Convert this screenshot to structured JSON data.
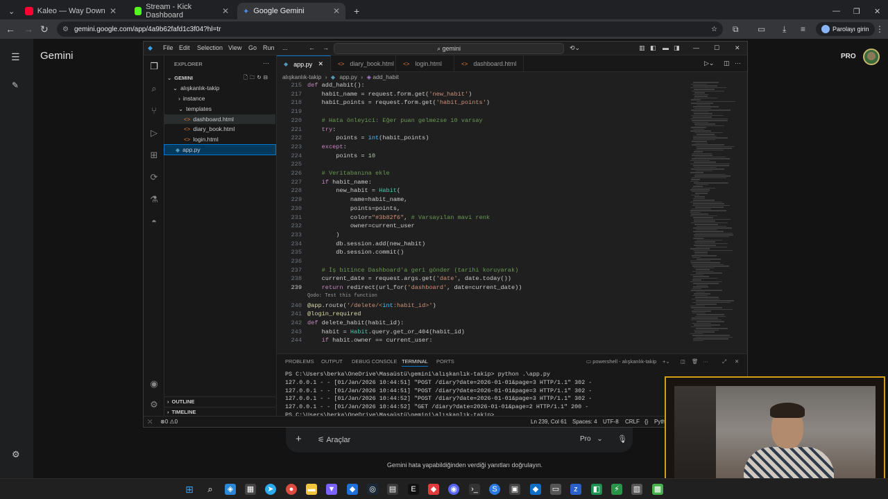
{
  "browser": {
    "tabs": [
      {
        "title": "Kaleo — Way Down We Go"
      },
      {
        "title": "Stream - Kick Dashboard"
      },
      {
        "title": "Google Gemini"
      }
    ],
    "url": "gemini.google.com/app/4a9b62fafd1c3f04?hl=tr",
    "profile_label": "Parolayı girin"
  },
  "gemini": {
    "title": "Gemini",
    "plan_badge": "PRO",
    "tools_label": "Araçlar",
    "model_label": "Pro",
    "disclaimer": "Gemini hata yapabildiğinden verdiği yanıtları doğrulayın."
  },
  "vscode": {
    "menu": [
      "File",
      "Edit",
      "Selection",
      "View",
      "Go",
      "Run",
      "..."
    ],
    "command_center": "gemini",
    "explorer": {
      "header": "EXPLORER",
      "root": "GEMINI",
      "project": "alışkanlık-takip",
      "items": [
        "instance",
        "templates",
        "dashboard.html",
        "diary_book.html",
        "login.html",
        "app.py"
      ],
      "sections": [
        "OUTLINE",
        "TIMELINE"
      ]
    },
    "tabs": [
      "app.py",
      "diary_book.html",
      "login.html",
      "dashboard.html"
    ],
    "breadcrumbs": [
      "alışkanlık-takip",
      "app.py",
      "add_habit"
    ],
    "codelens": "Qodo: Test this function",
    "code_lines": [
      {
        "n": "215",
        "t": "def add_habit():"
      },
      {
        "n": "217",
        "t": "    habit_name = request.form.get('new_habit')"
      },
      {
        "n": "218",
        "t": "    habit_points = request.form.get('habit_points')"
      },
      {
        "n": "219",
        "t": ""
      },
      {
        "n": "220",
        "t": "    # Hata önleyici: Eğer puan gelmezse 10 varsay"
      },
      {
        "n": "221",
        "t": "    try:"
      },
      {
        "n": "222",
        "t": "        points = int(habit_points)"
      },
      {
        "n": "223",
        "t": "    except:"
      },
      {
        "n": "224",
        "t": "        points = 10"
      },
      {
        "n": "225",
        "t": ""
      },
      {
        "n": "226",
        "t": "    # Veritabanına ekle"
      },
      {
        "n": "227",
        "t": "    if habit_name:"
      },
      {
        "n": "228",
        "t": "        new_habit = Habit("
      },
      {
        "n": "229",
        "t": "            name=habit_name,"
      },
      {
        "n": "230",
        "t": "            points=points,"
      },
      {
        "n": "231",
        "t": "            color=\"#3b82f6\", # Varsayılan mavi renk"
      },
      {
        "n": "232",
        "t": "            owner=current_user"
      },
      {
        "n": "233",
        "t": "        )"
      },
      {
        "n": "234",
        "t": "        db.session.add(new_habit)"
      },
      {
        "n": "235",
        "t": "        db.session.commit()"
      },
      {
        "n": "236",
        "t": ""
      },
      {
        "n": "237",
        "t": "    # İş bitince Dashboard'a geri gönder (tarihi koruyarak)"
      },
      {
        "n": "238",
        "t": "    current_date = request.args.get('date', date.today())"
      },
      {
        "n": "239",
        "t": "    return redirect(url_for('dashboard', date=current_date))"
      },
      {
        "n": "240",
        "t": "@app.route('/delete/<int:habit_id>')"
      },
      {
        "n": "241",
        "t": "@login_required"
      },
      {
        "n": "242",
        "t": "def delete_habit(habit_id):"
      },
      {
        "n": "243",
        "t": "    habit = Habit.query.get_or_404(habit_id)"
      },
      {
        "n": "244",
        "t": "    if habit.owner == current_user:"
      }
    ],
    "panel_tabs": [
      "PROBLEMS",
      "OUTPUT",
      "DEBUG CONSOLE",
      "TERMINAL",
      "PORTS"
    ],
    "terminal_name": "powershell - alışkanlık-takip",
    "terminal_lines": [
      "PS C:\\Users\\berka\\OneDrive\\Masaüstü\\gemini\\alışkanlık-takip> python .\\app.py",
      "127.0.0.1 - - [01/Jan/2026 10:44:51] \"POST /diary?date=2026-01-01&page=3 HTTP/1.1\" 302 -",
      "127.0.0.1 - - [01/Jan/2026 10:44:51] \"POST /diary?date=2026-01-01&page=3 HTTP/1.1\" 302 -",
      "127.0.0.1 - - [01/Jan/2026 10:44:52] \"POST /diary?date=2026-01-01&page=3 HTTP/1.1\" 302 -",
      "127.0.0.1 - - [01/Jan/2026 10:44:52] \"GET /diary?date=2026-01-01&page=2 HTTP/1.1\" 200 -",
      "PS C:\\Users\\berka\\OneDrive\\Masaüstü\\gemini\\alışkanlık-takip> "
    ],
    "status": {
      "errors": "0",
      "warnings": "0",
      "position": "Ln 239, Col 61",
      "spaces": "Spaces: 4",
      "encoding": "UTF-8",
      "eol": "CRLF",
      "language": "Pytho"
    }
  },
  "colors": {
    "accent": "#0078d4",
    "webcam_border": "#d4a017"
  }
}
